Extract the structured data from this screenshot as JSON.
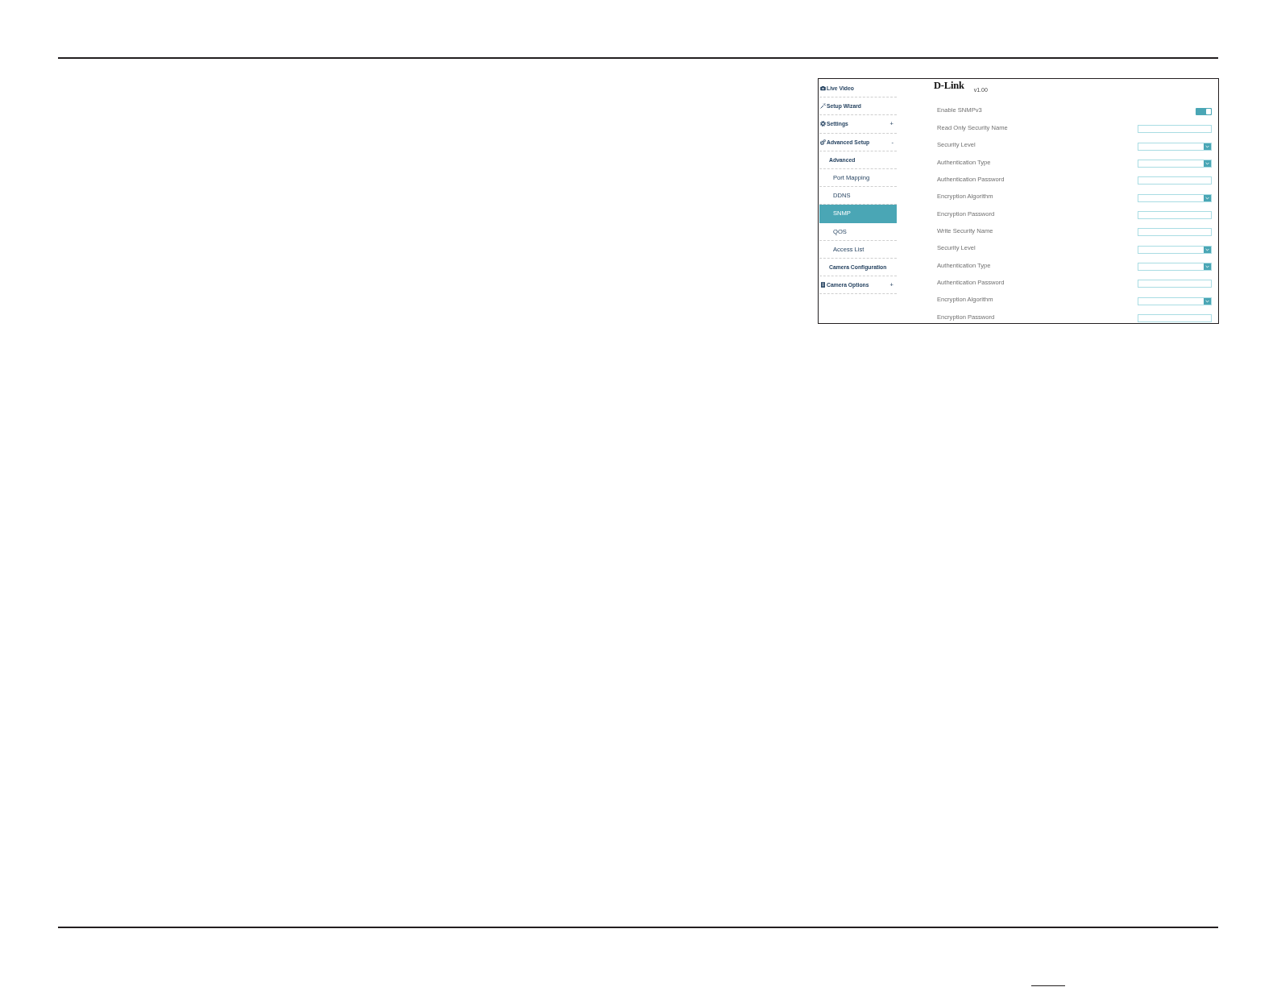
{
  "sidebar": {
    "items": [
      {
        "label": "Live Video",
        "selected": false
      },
      {
        "label": "Setup Wizard",
        "selected": false
      },
      {
        "label": "Settings",
        "expander": "+",
        "selected": false
      },
      {
        "label": "Advanced Setup",
        "expander": "-",
        "selected": false,
        "children": [
          {
            "label": "Advanced",
            "selected": false,
            "children": [
              {
                "label": "Port Mapping",
                "selected": false
              },
              {
                "label": "DDNS",
                "selected": false
              },
              {
                "label": "SNMP",
                "selected": true
              },
              {
                "label": "QOS",
                "selected": false
              },
              {
                "label": "Access List",
                "selected": false
              }
            ]
          },
          {
            "label": "Camera Configuration",
            "selected": false
          }
        ]
      },
      {
        "label": "Camera Options",
        "expander": "+",
        "selected": false
      }
    ]
  },
  "header": {
    "logo": "D-Link",
    "version": "v1.00"
  },
  "form": {
    "fields": [
      {
        "label": "Enable SNMPv3",
        "kind": "toggle",
        "on": true
      },
      {
        "label": "Read Only Security Name",
        "kind": "text"
      },
      {
        "label": "Security Level",
        "kind": "select"
      },
      {
        "label": "Authentication Type",
        "kind": "select"
      },
      {
        "label": "Authentication Password",
        "kind": "text"
      },
      {
        "label": "Encryption Algorithm",
        "kind": "select"
      },
      {
        "label": "Encryption Password",
        "kind": "text"
      },
      {
        "label": "Write Security Name",
        "kind": "text"
      },
      {
        "label": "Security Level",
        "kind": "select"
      },
      {
        "label": "Authentication Type",
        "kind": "select"
      },
      {
        "label": "Authentication Password",
        "kind": "text"
      },
      {
        "label": "Encryption Algorithm",
        "kind": "select"
      },
      {
        "label": "Encryption Password",
        "kind": "text"
      }
    ]
  }
}
